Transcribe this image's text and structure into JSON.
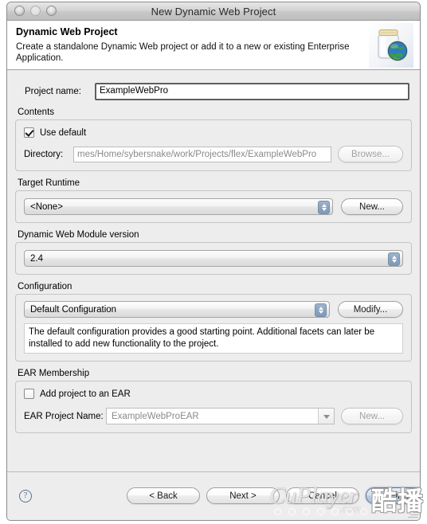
{
  "window": {
    "title": "New Dynamic Web Project",
    "traffic_lights": [
      "close",
      "minimize",
      "zoom"
    ]
  },
  "header": {
    "title": "Dynamic Web Project",
    "description": "Create a standalone Dynamic Web project or add it to a new or existing Enterprise Application.",
    "icon": "jar-globe-icon"
  },
  "form": {
    "project_name_label": "Project name:",
    "project_name_value": "ExampleWebPro",
    "project_name_placeholder": "",
    "contents": {
      "group_title": "Contents",
      "use_default_label": "Use default",
      "use_default_checked": true,
      "directory_label": "Directory:",
      "directory_value": "mes/Home/sybersnake/work/Projects/flex/ExampleWebPro",
      "browse_label": "Browse..."
    },
    "target_runtime": {
      "group_title": "Target Runtime",
      "selected": "<None>",
      "new_label": "New..."
    },
    "module_version": {
      "group_title": "Dynamic Web Module version",
      "selected": "2.4"
    },
    "configuration": {
      "group_title": "Configuration",
      "selected": "Default Configuration",
      "modify_label": "Modify...",
      "description": "The default configuration provides a good starting point. Additional facets can later be installed to add new functionality to the project."
    },
    "ear_membership": {
      "group_title": "EAR Membership",
      "add_to_ear_label": "Add project to an EAR",
      "add_to_ear_checked": false,
      "ear_project_name_label": "EAR Project Name:",
      "ear_project_name_value": "ExampleWebProEAR",
      "new_label": "New..."
    }
  },
  "footer": {
    "help_glyph": "?",
    "back_label": "< Back",
    "next_label": "Next >",
    "cancel_label": "Cancel",
    "finish_label": "Finish"
  },
  "watermark": {
    "brand": "CuPlayer",
    "domain": ".com",
    "cn": "酷播"
  },
  "colors": {
    "window_bg": "#ededed",
    "header_bg": "#ffffff",
    "field_bg": "#ffffff",
    "accent_blue": "#8ba4c0",
    "default_button": "#bccbe3",
    "help_icon": "#5d7390"
  }
}
